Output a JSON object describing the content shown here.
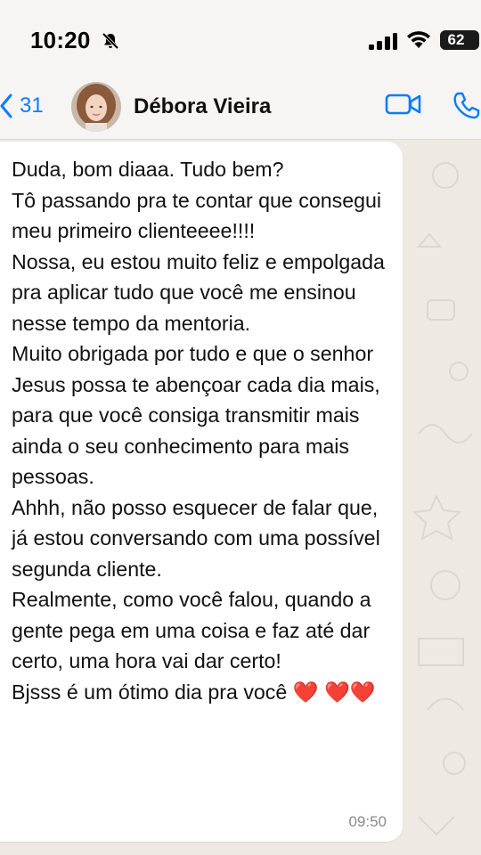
{
  "status_bar": {
    "time": "10:20",
    "battery": "62",
    "icons": [
      "bell-slash-icon",
      "signal-icon",
      "wifi-icon",
      "battery-icon"
    ]
  },
  "header": {
    "back_count": "31",
    "contact_name": "Débora Vieira",
    "icons": [
      "chevron-left-icon",
      "video-call-icon",
      "phone-icon"
    ],
    "accent_color": "#0a7cff"
  },
  "message": {
    "text": "Duda, bom diaaa. Tudo bem?\nTô passando pra te contar que consegui meu primeiro clienteeee!!!!\nNossa, eu estou muito feliz e empolgada pra aplicar tudo que você me ensinou nesse tempo da mentoria.\nMuito obrigada por tudo e que o senhor Jesus possa te abençoar cada dia mais, para que você consiga transmitir mais ainda o seu conhecimento para mais pessoas.\nAhhh, não posso esquecer de falar que, já estou conversando com uma possível segunda cliente.\nRealmente, como você falou, quando a gente pega em uma coisa e faz até dar certo, uma hora vai dar certo!\nBjsss é um ótimo dia pra você ❤️ ❤️❤️",
    "time": "09:50"
  },
  "colors": {
    "chat_background": "#eeeae3",
    "bubble": "#ffffff",
    "header": "#f6f5f3"
  }
}
